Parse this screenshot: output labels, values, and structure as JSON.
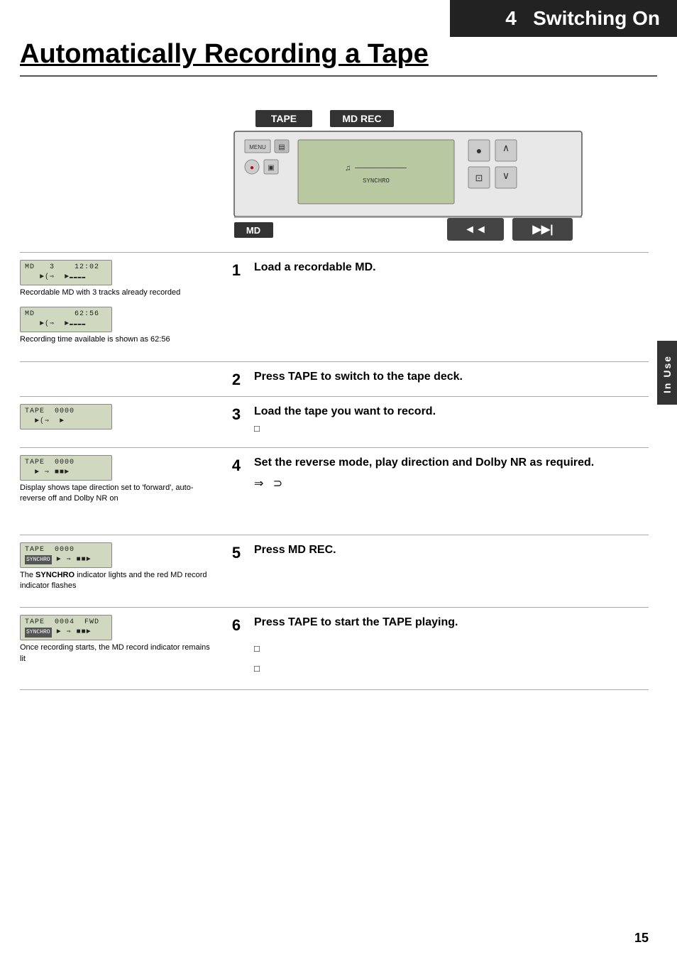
{
  "header": {
    "section_number": "4",
    "section_title": "Switching On"
  },
  "page": {
    "title": "Automatically Recording a Tape",
    "number": "15",
    "side_tab": "In Use"
  },
  "device": {
    "tape_label": "TAPE",
    "md_rec_label": "MD REC",
    "md_label": "MD",
    "prev_label": "◄◄",
    "next_label": "▶▶|"
  },
  "steps": [
    {
      "number": "1",
      "instruction": "Load a recordable MD.",
      "left_displays": [
        {
          "lcd_line1": "MD    3    12:02",
          "lcd_line2": "   ►(⇒  ►■■■■■",
          "caption": "Recordable MD with 3 tracks already recorded"
        },
        {
          "lcd_line1": "MD         62:56",
          "lcd_line2": "   ►(⇒  ►■■■■■",
          "caption": "Recording time available is shown as 62:56"
        }
      ]
    },
    {
      "number": "2",
      "instruction": "Press TAPE to switch to the tape deck.",
      "left_displays": []
    },
    {
      "number": "3",
      "instruction": "Load the tape you want to record.",
      "left_displays": [
        {
          "lcd_line1": "TAPE  0000",
          "lcd_line2": "   ►(⇒  ►",
          "caption": ""
        }
      ],
      "extra": "□"
    },
    {
      "number": "4",
      "instruction": "Set the reverse mode, play direction and Dolby NR as required.",
      "left_displays": [
        {
          "lcd_line1": "TAPE  0000",
          "lcd_line2": "   ► ⇒ ■■►",
          "caption": "Display shows tape direction set to 'forward', auto-reverse off and Dolby NR on"
        }
      ],
      "extra_symbols": "⇒  ⊃"
    },
    {
      "number": "5",
      "instruction": "Press MD REC.",
      "left_displays": [
        {
          "lcd_line1": "TAPE  0000",
          "lcd_line2": "SYNCHRO  ► ⇒ ■■►",
          "caption": "The SYNCHRO indicator lights and the red MD record indicator flashes"
        }
      ]
    },
    {
      "number": "6",
      "instruction": "Press TAPE to start the TAPE playing.",
      "left_displays": [
        {
          "lcd_line1": "TAPE  0004  FWD",
          "lcd_line2": "SYNCHRO  ► ⇒ ■■►",
          "caption": "Once recording starts, the MD record indicator remains lit"
        }
      ],
      "extra_bottom": [
        "□",
        "□"
      ]
    }
  ]
}
